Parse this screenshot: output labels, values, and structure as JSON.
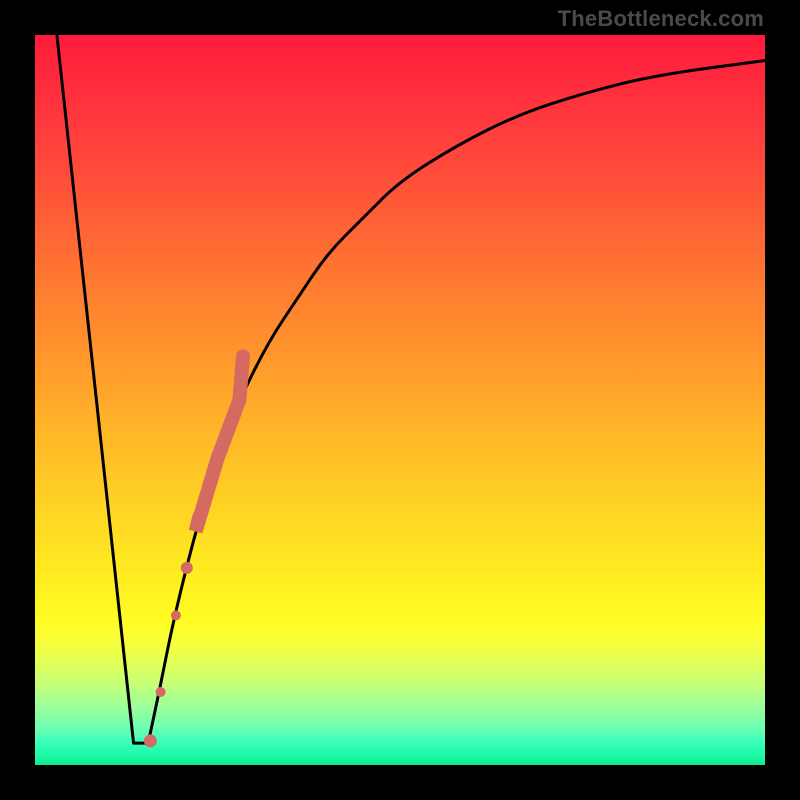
{
  "watermark": "TheBottleneck.com",
  "colors": {
    "background": "#000000",
    "curve": "#000000",
    "marker": "#d46a62"
  },
  "chart_data": {
    "type": "line",
    "title": "",
    "xlabel": "",
    "ylabel": "",
    "xlim": [
      0,
      100
    ],
    "ylim": [
      0,
      100
    ],
    "series": [
      {
        "name": "left-descending",
        "x": [
          3,
          13.5
        ],
        "y": [
          100,
          3
        ]
      },
      {
        "name": "flat-valley",
        "x": [
          13.5,
          15.5
        ],
        "y": [
          3,
          3
        ]
      },
      {
        "name": "right-ascending",
        "x": [
          15.5,
          17,
          19,
          22,
          25,
          28,
          32,
          36,
          40,
          45,
          50,
          58,
          66,
          75,
          85,
          100
        ],
        "y": [
          3,
          10,
          20,
          32,
          42,
          50,
          58,
          64,
          70,
          75,
          80,
          85,
          89,
          92,
          94.5,
          96.5
        ]
      }
    ],
    "highlight": {
      "name": "marker-band",
      "color": "#d46a62",
      "band": {
        "x": [
          22.5,
          28.5
        ],
        "y": [
          34,
          56
        ]
      },
      "dots": [
        {
          "x": 20.8,
          "y": 27
        },
        {
          "x": 19.3,
          "y": 20.5
        },
        {
          "x": 17.2,
          "y": 10
        },
        {
          "x": 15.8,
          "y": 3.3
        }
      ]
    },
    "has_axes": false,
    "has_legend": false,
    "has_grid": false
  }
}
